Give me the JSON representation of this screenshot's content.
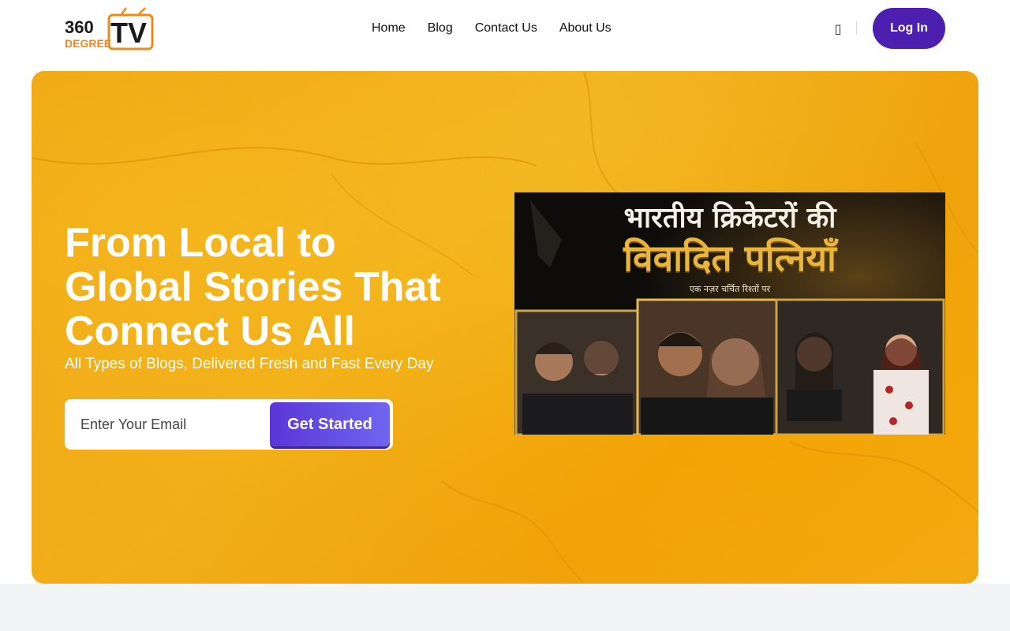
{
  "brand": {
    "logo_top": "360",
    "logo_tv": "TV",
    "logo_bottom": "DEGREE",
    "logo_top_color": "#1a1a1a",
    "logo_accent_color": "#f08a16"
  },
  "nav": {
    "items": [
      {
        "label": "Home"
      },
      {
        "label": "Blog"
      },
      {
        "label": "Contact Us"
      },
      {
        "label": "About Us"
      }
    ]
  },
  "header": {
    "search_icon": "search-icon",
    "search_glyph": "▯",
    "login_label": "Log In",
    "login_color": "#4c1fb0"
  },
  "hero": {
    "title_lines": [
      "From Local to",
      "Global Stories That",
      "Connect Us All"
    ],
    "subtitle": "All Types of Blogs, Delivered Fresh and Fast Every Day",
    "email_placeholder": "Enter Your Email",
    "cta_label": "Get Started",
    "background_color": "#f7a715",
    "cta_color": "#5a36d6"
  },
  "featured_post": {
    "line1": "भारतीय क्रिकेटरों की",
    "line2": "विवादित पत्नियाँ",
    "line3": "एक नज़र चर्चित रिश्तों पर"
  }
}
